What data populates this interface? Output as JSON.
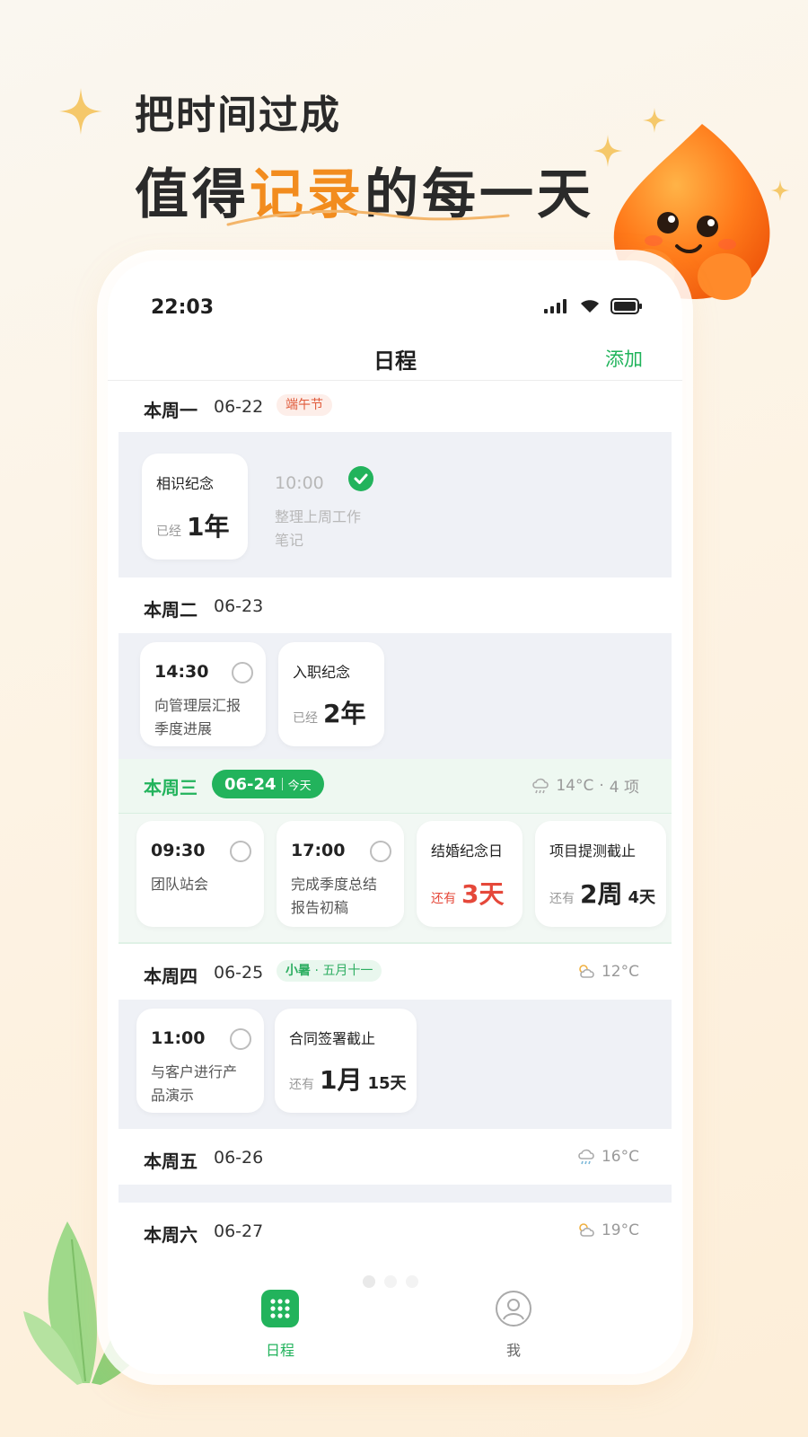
{
  "headline": {
    "line1": "把时间过成",
    "line2_pre": "值得",
    "line2_highlight": "记录",
    "line2_post": "的每一天"
  },
  "colors": {
    "accent": "#1fb35a",
    "highlight": "#f28c1e",
    "alert": "#e5483a"
  },
  "status_bar": {
    "time": "22:03"
  },
  "nav": {
    "title": "日程",
    "add": "添加"
  },
  "days": {
    "mon": {
      "name": "本周一",
      "date": "06-22",
      "tag": "端午节"
    },
    "tue": {
      "name": "本周二",
      "date": "06-23"
    },
    "wed": {
      "name": "本周三",
      "date": "06-24",
      "today": "今天",
      "weather": "14°C",
      "count": "4 项"
    },
    "thu": {
      "name": "本周四",
      "date": "06-25",
      "tag_term": "小暑",
      "tag_lunar": "五月十一",
      "weather": "12°C"
    },
    "fri": {
      "name": "本周五",
      "date": "06-26",
      "weather": "16°C"
    },
    "sat": {
      "name": "本周六",
      "date": "06-27",
      "weather": "19°C"
    }
  },
  "cards": {
    "mon_anniv": {
      "label": "相识纪念",
      "prefix": "已经",
      "value": "1年"
    },
    "mon_task": {
      "time": "10:00",
      "desc1": "整理上周工作",
      "desc2": "笔记",
      "done": true
    },
    "tue_task": {
      "time": "14:30",
      "desc1": "向管理层汇报",
      "desc2": "季度进展"
    },
    "tue_anniv": {
      "label": "入职纪念",
      "prefix": "已经",
      "value": "2年"
    },
    "wed_task1": {
      "time": "09:30",
      "desc1": "团队站会"
    },
    "wed_task2": {
      "time": "17:00",
      "desc1": "完成季度总结",
      "desc2": "报告初稿"
    },
    "wed_anniv": {
      "label": "结婚纪念日",
      "prefix": "还有",
      "value": "3天"
    },
    "wed_deadline": {
      "label": "项目提测截止",
      "prefix": "还有",
      "value": "2周",
      "extra": "4天"
    },
    "thu_task": {
      "time": "11:00",
      "desc1": "与客户进行产",
      "desc2": "品演示"
    },
    "thu_deadline": {
      "label": "合同签署截止",
      "prefix": "还有",
      "value": "1月",
      "extra": "15天"
    }
  },
  "tabs": {
    "schedule": "日程",
    "me": "我"
  }
}
